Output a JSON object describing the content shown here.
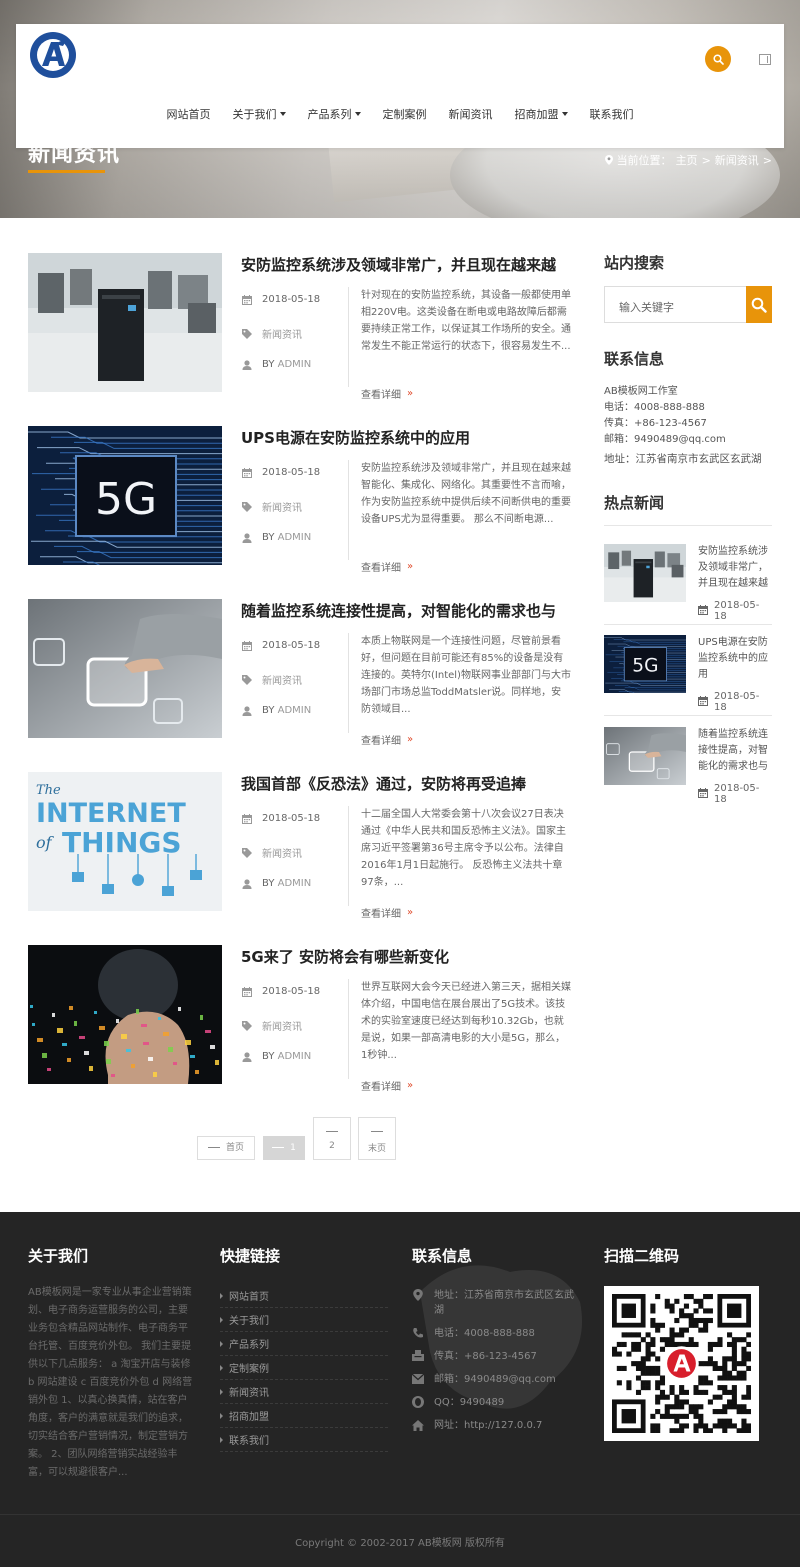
{
  "header": {
    "nav": [
      {
        "label": "网站首页",
        "dropdown": false
      },
      {
        "label": "关于我们",
        "dropdown": true
      },
      {
        "label": "产品系列",
        "dropdown": true
      },
      {
        "label": "定制案例",
        "dropdown": false
      },
      {
        "label": "新闻资讯",
        "dropdown": false
      },
      {
        "label": "招商加盟",
        "dropdown": true
      },
      {
        "label": "联系我们",
        "dropdown": false
      }
    ]
  },
  "banner": {
    "title": "新闻资讯",
    "breadcrumb_prefix": "当前位置：",
    "breadcrumb_home": "主页",
    "breadcrumb_sep1": " > ",
    "breadcrumb_current": "新闻资讯",
    "breadcrumb_sep2": " >"
  },
  "posts": [
    {
      "title": "安防监控系统涉及领域非常广，并且现在越来越",
      "date": "2018-05-18",
      "category": "新闻资讯",
      "by_prefix": "BY ",
      "author": "ADMIN",
      "excerpt": "针对现在的安防监控系统，其设备一般都使用单相220V电。这类设备在断电或电路故障后都需要持续正常工作，以保证其工作场所的安全。通常发生不能正常运行的状态下，很容易发生不...",
      "more": "查看详细",
      "more_arrow": "»",
      "thumb": "ups"
    },
    {
      "title": "UPS电源在安防监控系统中的应用",
      "date": "2018-05-18",
      "category": "新闻资讯",
      "by_prefix": "BY ",
      "author": "ADMIN",
      "excerpt": "安防监控系统涉及领域非常广，并且现在越来越智能化、集成化、网络化。其重要性不言而喻，作为安防监控系统中提供后续不间断供电的重要设备UPS尤为显得重要。 那么不间断电源...",
      "more": "查看详细",
      "more_arrow": "»",
      "thumb": "5g"
    },
    {
      "title": "随着监控系统连接性提高，对智能化的需求也与",
      "date": "2018-05-18",
      "category": "新闻资讯",
      "by_prefix": "BY ",
      "author": "ADMIN",
      "excerpt": "本质上物联网是一个连接性问题，尽管前景看好，但问题在目前可能还有85%的设备是没有连接的。英特尔(Intel)物联网事业部部门与大市场部门市场总监ToddMatsler说。同样地，安防领域目...",
      "more": "查看详细",
      "more_arrow": "»",
      "thumb": "touch"
    },
    {
      "title": "我国首部《反恐法》通过，安防将再受追捧",
      "date": "2018-05-18",
      "category": "新闻资讯",
      "by_prefix": "BY ",
      "author": "ADMIN",
      "excerpt": "十二届全国人大常委会第十八次会议27日表决通过《中华人民共和国反恐怖主义法》。国家主席习近平签署第36号主席令予以公布。法律自2016年1月1日起施行。 反恐怖主义法共十章97条，...",
      "more": "查看详细",
      "more_arrow": "»",
      "thumb": "iot",
      "iot_line1": "The",
      "iot_line2": "INTERNET",
      "iot_line3": "of",
      "iot_line4": "THINGS"
    },
    {
      "title": "5G来了 安防将会有哪些新变化",
      "date": "2018-05-18",
      "category": "新闻资讯",
      "by_prefix": "BY ",
      "author": "ADMIN",
      "excerpt": "世界互联网大会今天已经进入第三天，据相关媒体介绍，中国电信在展台展出了5G技术。该技术的实验室速度已经达到每秒10.32Gb，也就是说，如果一部高清电影的大小是5G，那么，1秒钟...",
      "more": "查看详细",
      "more_arrow": "»",
      "thumb": "hand"
    }
  ],
  "thumb_5g_text": "5G",
  "pagination": {
    "first": "首页",
    "current": "1",
    "next": "2",
    "last": "末页"
  },
  "sidebar": {
    "search_title": "站内搜索",
    "search_placeholder": "输入关键字",
    "contact_title": "联系信息",
    "company": "AB模板网工作室",
    "phone": "电话：4008-888-888",
    "fax": "传真：+86-123-4567",
    "email": "邮箱：9490489@qq.com",
    "address": "地址：江苏省南京市玄武区玄武湖",
    "hot_title": "热点新闻",
    "hot": [
      {
        "title": "安防监控系统涉及领域非常广，并且现在越来越",
        "date": "2018-05-18",
        "thumb": "ups"
      },
      {
        "title": "UPS电源在安防监控系统中的应用",
        "date": "2018-05-18",
        "thumb": "5g"
      },
      {
        "title": "随着监控系统连接性提高，对智能化的需求也与",
        "date": "2018-05-18",
        "thumb": "touch"
      }
    ]
  },
  "footer": {
    "about_title": "关于我们",
    "about_text": "AB模板网是一家专业从事企业营销策划、电子商务运营服务的公司，主要业务包含精品网站制作、电子商务平台托管、百度竞价外包。 我们主要提供以下几点服务： a 淘宝开店与装修 b 网站建设 c 百度竞价外包 d 网络营销外包 1、以真心换真情，站在客户角度，客户的满意就是我们的追求，切实结合客户营销情况，制定营销方案。 2、团队网络营销实战经验丰富，可以规避很客户...",
    "links_title": "快捷链接",
    "links": [
      "网站首页",
      "关于我们",
      "产品系列",
      "定制案例",
      "新闻资讯",
      "招商加盟",
      "联系我们"
    ],
    "contact_title": "联系信息",
    "contact": [
      {
        "icon": "map-marker-icon",
        "text": "地址：江苏省南京市玄武区玄武湖"
      },
      {
        "icon": "phone-icon",
        "text": "电话：4008-888-888"
      },
      {
        "icon": "fax-icon",
        "text": "传真：+86-123-4567"
      },
      {
        "icon": "envelope-icon",
        "text": "邮箱：9490489@qq.com"
      },
      {
        "icon": "qq-icon",
        "text": "QQ：9490489"
      },
      {
        "icon": "home-icon",
        "text": "网址：http://127.0.0.7"
      }
    ],
    "qr_title": "扫描二维码",
    "copyright": "Copyright © 2002-2017 AB模板网 版权所有"
  },
  "colors": {
    "accent": "#e8940a",
    "logo_blue": "#1f4f9c",
    "arrow_red": "#e04b2b",
    "footer_bg": "#252525"
  }
}
